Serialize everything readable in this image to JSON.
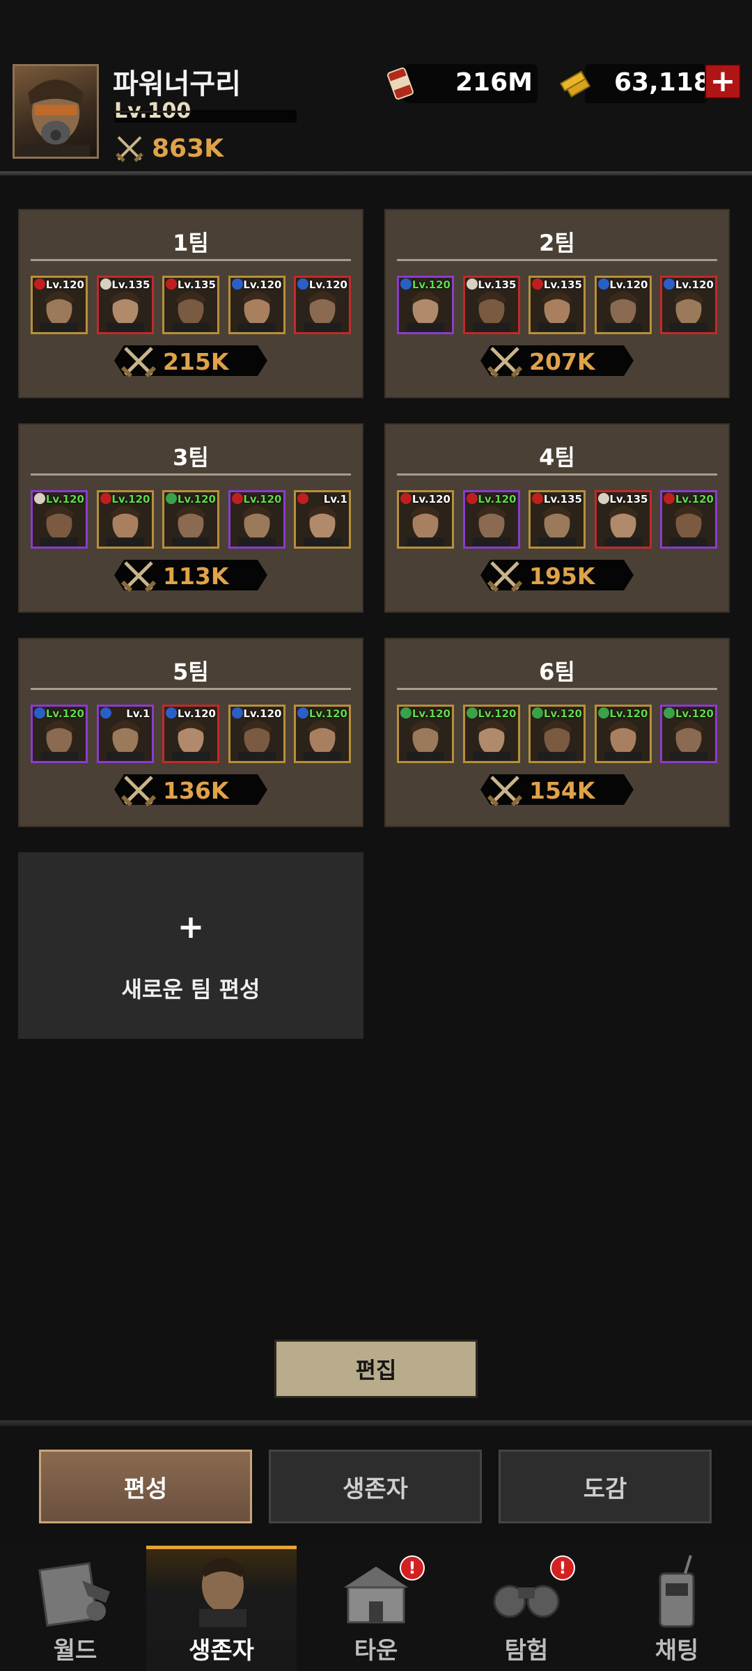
{
  "player": {
    "name": "파워너구리",
    "level": "Lv.100",
    "power": "863K"
  },
  "resources": {
    "item1": {
      "icon": "ration-can-icon",
      "value": "216M"
    },
    "item2": {
      "icon": "gold-bars-icon",
      "value": "63,118"
    },
    "plus_label": "+"
  },
  "teams": [
    {
      "name": "1팀",
      "power": "215K",
      "members": [
        {
          "level": "Lv.120",
          "frame": "gold",
          "badge": "red",
          "green": false
        },
        {
          "level": "Lv.135",
          "frame": "red",
          "badge": "skull",
          "green": false
        },
        {
          "level": "Lv.135",
          "frame": "gold",
          "badge": "red",
          "green": false
        },
        {
          "level": "Lv.120",
          "frame": "gold",
          "badge": "blue",
          "green": false
        },
        {
          "level": "Lv.120",
          "frame": "red",
          "badge": "blue",
          "green": false
        }
      ]
    },
    {
      "name": "2팀",
      "power": "207K",
      "members": [
        {
          "level": "Lv.120",
          "frame": "purple",
          "badge": "blue",
          "green": true
        },
        {
          "level": "Lv.135",
          "frame": "red",
          "badge": "skull",
          "green": false
        },
        {
          "level": "Lv.135",
          "frame": "gold",
          "badge": "red",
          "green": false
        },
        {
          "level": "Lv.120",
          "frame": "gold",
          "badge": "blue",
          "green": false
        },
        {
          "level": "Lv.120",
          "frame": "red",
          "badge": "blue",
          "green": false
        }
      ]
    },
    {
      "name": "3팀",
      "power": "113K",
      "members": [
        {
          "level": "Lv.120",
          "frame": "purple",
          "badge": "skull",
          "green": true
        },
        {
          "level": "Lv.120",
          "frame": "gold",
          "badge": "red",
          "green": true
        },
        {
          "level": "Lv.120",
          "frame": "gold",
          "badge": "green",
          "green": true
        },
        {
          "level": "Lv.120",
          "frame": "purple",
          "badge": "red",
          "green": true
        },
        {
          "level": "Lv.1",
          "frame": "gold",
          "badge": "red",
          "green": false
        }
      ]
    },
    {
      "name": "4팀",
      "power": "195K",
      "members": [
        {
          "level": "Lv.120",
          "frame": "gold",
          "badge": "red",
          "green": false
        },
        {
          "level": "Lv.120",
          "frame": "purple",
          "badge": "red",
          "green": true
        },
        {
          "level": "Lv.135",
          "frame": "gold",
          "badge": "red",
          "green": false
        },
        {
          "level": "Lv.135",
          "frame": "red",
          "badge": "skull",
          "green": false
        },
        {
          "level": "Lv.120",
          "frame": "purple",
          "badge": "red",
          "green": true
        }
      ]
    },
    {
      "name": "5팀",
      "power": "136K",
      "members": [
        {
          "level": "Lv.120",
          "frame": "purple",
          "badge": "blue",
          "green": true
        },
        {
          "level": "Lv.1",
          "frame": "purple",
          "badge": "blue",
          "green": false
        },
        {
          "level": "Lv.120",
          "frame": "red",
          "badge": "blue",
          "green": false
        },
        {
          "level": "Lv.120",
          "frame": "gold",
          "badge": "blue",
          "green": false
        },
        {
          "level": "Lv.120",
          "frame": "gold",
          "badge": "blue",
          "green": true
        }
      ]
    },
    {
      "name": "6팀",
      "power": "154K",
      "members": [
        {
          "level": "Lv.120",
          "frame": "gold",
          "badge": "green",
          "green": true
        },
        {
          "level": "Lv.120",
          "frame": "gold",
          "badge": "green",
          "green": true
        },
        {
          "level": "Lv.120",
          "frame": "gold",
          "badge": "green",
          "green": true
        },
        {
          "level": "Lv.120",
          "frame": "gold",
          "badge": "green",
          "green": true
        },
        {
          "level": "Lv.120",
          "frame": "purple",
          "badge": "green",
          "green": true
        }
      ]
    }
  ],
  "new_team": {
    "plus": "+",
    "label": "새로운 팀 편성"
  },
  "edit_button": "편집",
  "subtabs": [
    "편성",
    "생존자",
    "도감"
  ],
  "nav": [
    {
      "label": "월드",
      "icon": "world-map-icon",
      "alert": false
    },
    {
      "label": "생존자",
      "icon": "survivor-icon",
      "alert": false
    },
    {
      "label": "타운",
      "icon": "town-icon",
      "alert": true
    },
    {
      "label": "탐험",
      "icon": "binoculars-icon",
      "alert": true
    },
    {
      "label": "채팅",
      "icon": "radio-icon",
      "alert": false
    }
  ],
  "alert_mark": "!",
  "colors": {
    "accent": "#e0a24a",
    "card": "#4a4035",
    "background": "#111111",
    "alert": "#d32121"
  }
}
